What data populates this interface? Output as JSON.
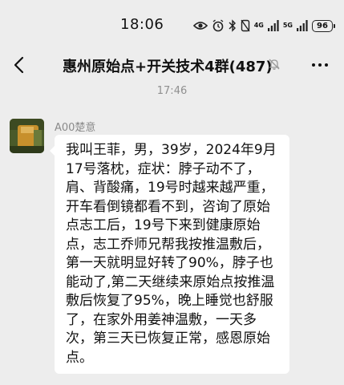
{
  "status_bar": {
    "time": "18:06",
    "network_1": "4G",
    "network_2": "5G",
    "battery": "96"
  },
  "header": {
    "title": "惠州原始点+开关技术4群(487)"
  },
  "chat": {
    "timestamp": "17:46",
    "messages": [
      {
        "sender": "A00楚意",
        "text": "我叫王菲，男，39岁，2024年9月17号落枕，症状：脖子动不了，肩、背酸痛，19号时越来越严重，开车看倒镜都看不到，咨询了原始点志工后，19号下来到健康原始点，志工乔师兄帮我按推温敷后，第一天就明显好转了90%，脖子也能动了,第二天继续来原始点按推温敷后恢复了95%，晚上睡觉也舒服了，在家外用姜神温敷，一天多次，第三天已恢复正常，感恩原始点。"
      }
    ]
  },
  "colors": {
    "background": "#ededed",
    "bubble": "#ffffff",
    "meta_text": "#8f8f8f"
  },
  "icons": [
    "eye-icon",
    "alarm-icon",
    "bluetooth-icon",
    "silent-icon",
    "signal-icon",
    "battery-icon",
    "back-arrow-icon",
    "mute-bell-icon",
    "more-icon"
  ]
}
